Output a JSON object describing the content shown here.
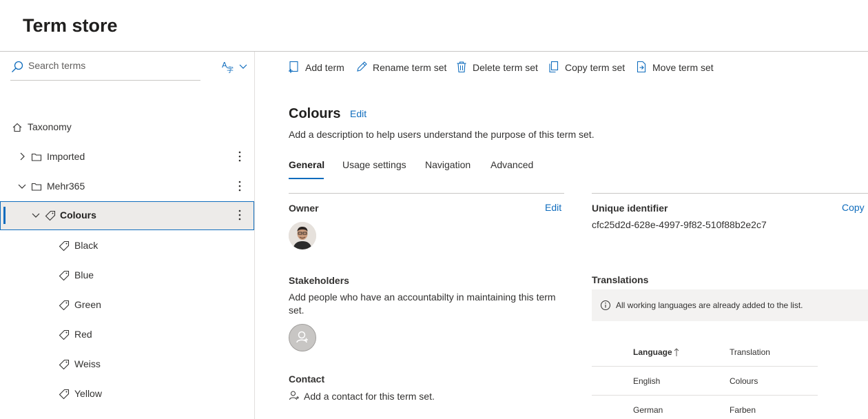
{
  "header": {
    "title": "Term store"
  },
  "search": {
    "placeholder": "Search terms"
  },
  "tree": {
    "root": "Taxonomy",
    "groups": [
      {
        "label": "Imported"
      },
      {
        "label": "Mehr365"
      }
    ],
    "selected_set": "Colours",
    "terms": [
      "Black",
      "Blue",
      "Green",
      "Red",
      "Weiss",
      "Yellow"
    ]
  },
  "toolbar": {
    "add_term": "Add term",
    "rename_term_set": "Rename term set",
    "delete_term_set": "Delete term set",
    "copy_term_set": "Copy term set",
    "move_term_set": "Move term set"
  },
  "termset": {
    "title": "Colours",
    "edit_label": "Edit",
    "description": "Add a description to help users understand the purpose of this term set."
  },
  "tabs": [
    "General",
    "Usage settings",
    "Navigation",
    "Advanced"
  ],
  "owner": {
    "label": "Owner",
    "edit_label": "Edit"
  },
  "stakeholders": {
    "label": "Stakeholders",
    "text_line1": "Add people who have an accountabilty in maintaining this term",
    "text_line2": "set."
  },
  "contact": {
    "label": "Contact",
    "add_text": "Add a contact for this term set."
  },
  "identifier": {
    "label": "Unique identifier",
    "copy_label": "Copy",
    "value": "cfc25d2d-628e-4997-9f82-510f88b2e2c7"
  },
  "translations": {
    "label": "Translations",
    "info": "All working languages are already added to the list.",
    "columns": {
      "language": "Language",
      "translation": "Translation"
    },
    "rows": [
      {
        "language": "English",
        "translation": "Colours"
      },
      {
        "language": "German",
        "translation": "Farben"
      }
    ]
  },
  "colors": {
    "accent": "#0f6cbd",
    "selected_bg": "#edebe9"
  }
}
